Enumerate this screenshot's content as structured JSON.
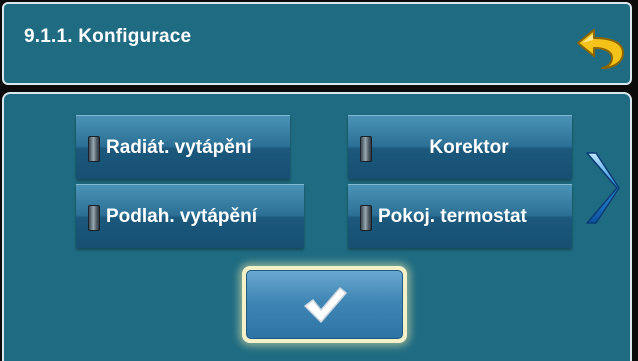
{
  "header": {
    "title": "9.1.1. Konfigurace",
    "back_icon": "undo-arrow-icon"
  },
  "options": [
    {
      "label": "Radiát. vytápění",
      "icon": "indicator-lamp-icon"
    },
    {
      "label": "Podlah. vytápění",
      "icon": "indicator-lamp-icon"
    },
    {
      "label": "Korektor",
      "icon": "indicator-lamp-icon"
    },
    {
      "label": "Pokoj. termostat",
      "icon": "indicator-lamp-icon"
    }
  ],
  "navigation": {
    "next_icon": "chevron-right-icon"
  },
  "confirm": {
    "icon": "checkmark-icon"
  },
  "colors": {
    "background": "#1f6c82",
    "border": "#d9e8ee",
    "button": "#2b6f94",
    "confirm_glow": "#f4f1c8",
    "back_arrow": "#f5c21a"
  }
}
